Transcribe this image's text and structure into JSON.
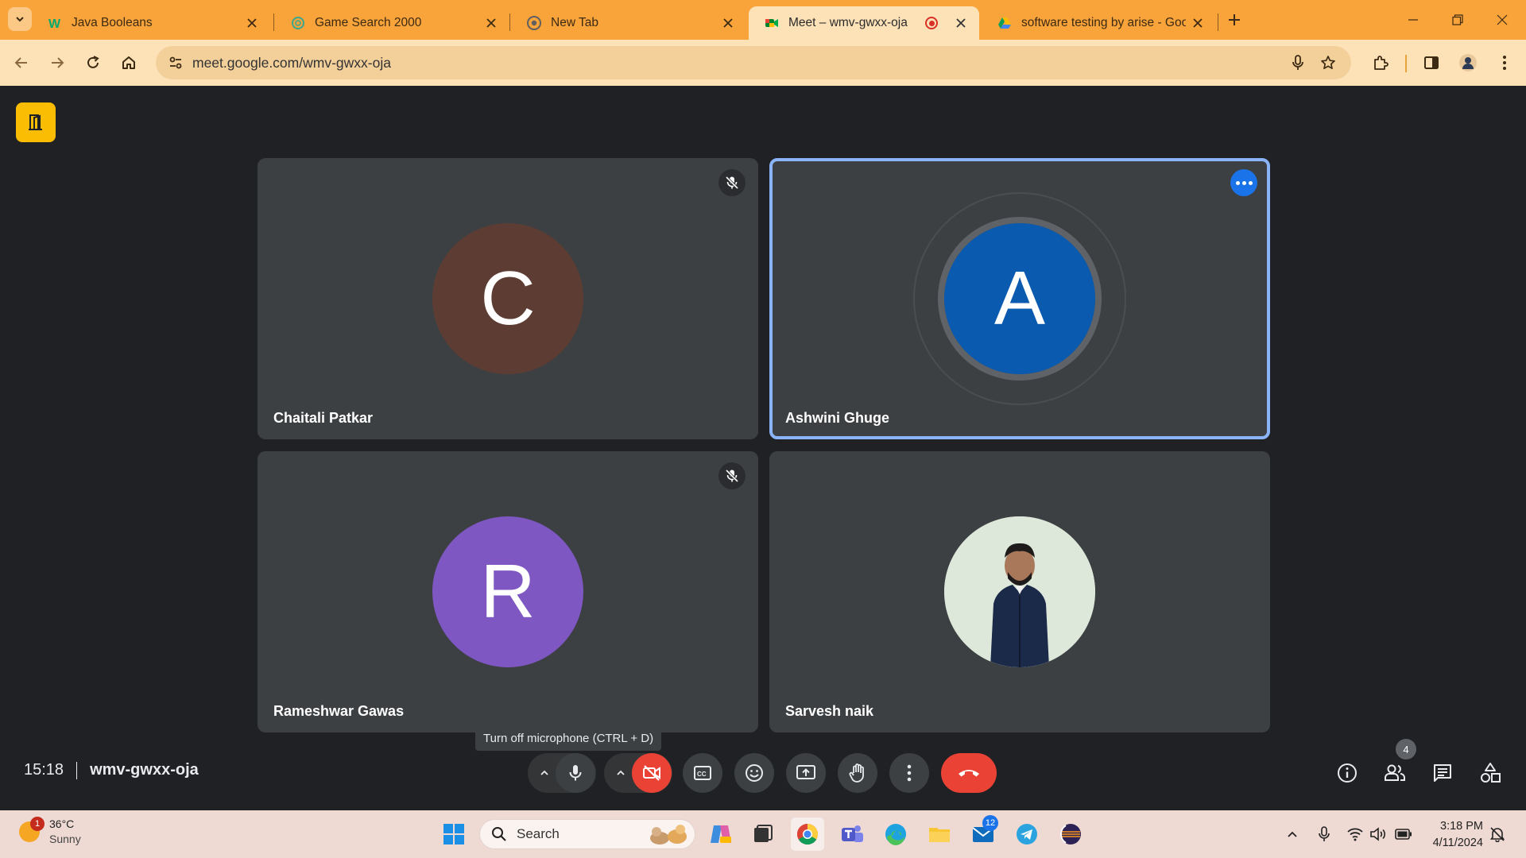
{
  "browser": {
    "tabs": [
      {
        "label": "Java Booleans"
      },
      {
        "label": "Game Search 2000"
      },
      {
        "label": "New Tab"
      },
      {
        "label": "Meet – wmv-gwxx-oja"
      },
      {
        "label": "software testing by arise - Goo"
      }
    ],
    "url": "meet.google.com/wmv-gwxx-oja"
  },
  "meet": {
    "participants": [
      {
        "name": "Chaitali Patkar",
        "initial": "C",
        "color": "#5d3d33",
        "muted": true
      },
      {
        "name": "Ashwini Ghuge",
        "initial": "A",
        "color": "#0a5bb0",
        "speaking": true
      },
      {
        "name": "Rameshwar Gawas",
        "initial": "R",
        "color": "#7e57c2",
        "muted": true
      },
      {
        "name": "Sarvesh naik",
        "photo": true
      }
    ],
    "tooltip": "Turn off microphone (CTRL + D)",
    "time": "15:18",
    "meeting_code": "wmv-gwxx-oja",
    "people_count": "4"
  },
  "taskbar": {
    "weather_badge": "1",
    "temperature": "36°C",
    "condition": "Sunny",
    "search_label": "Search",
    "mail_badge": "12",
    "clock_time": "3:18 PM",
    "clock_date": "4/11/2024"
  }
}
